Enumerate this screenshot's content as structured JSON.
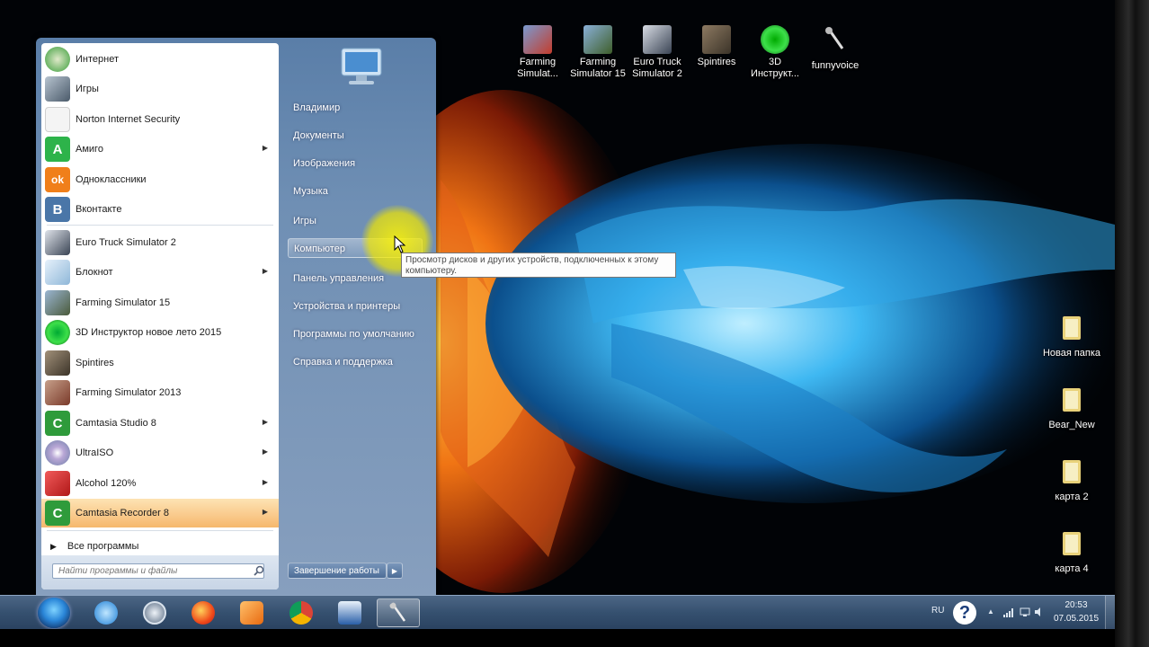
{
  "desktop_icons": [
    {
      "label": "Farming Simulat...",
      "icon": "farming-simulator-icon"
    },
    {
      "label": "Farming Simulator 15",
      "icon": "farming-simulator-15-icon"
    },
    {
      "label": "Euro Truck Simulator 2",
      "icon": "euro-truck-icon"
    },
    {
      "label": "Spintires",
      "icon": "spintires-icon"
    },
    {
      "label": "3D Инструкт...",
      "icon": "3d-instructor-icon"
    },
    {
      "label": "funnyvoice",
      "icon": "microphone-icon"
    },
    {
      "label": "Новая папка",
      "icon": "folder-icon"
    },
    {
      "label": "Bear_New",
      "icon": "folder-icon"
    },
    {
      "label": "карта 2",
      "icon": "folder-icon"
    },
    {
      "label": "карта 4",
      "icon": "folder-icon"
    }
  ],
  "start_menu": {
    "programs": [
      {
        "label": "Интернет",
        "icon": "internet-icon",
        "color": "#3a9d3a"
      },
      {
        "label": "Игры",
        "icon": "games-icon",
        "color": "#6b7b8c"
      },
      {
        "label": "Norton Internet Security",
        "icon": "norton-icon",
        "color": "#f0f0f0"
      },
      {
        "label": "Амиго",
        "icon": "amigo-icon",
        "color": "#2db34a",
        "glyph": "A"
      },
      {
        "label": "Одноклассники",
        "icon": "odnoklassniki-icon",
        "color": "#f07f1a",
        "glyph": "ok"
      },
      {
        "label": "Вконтакте",
        "icon": "vkontakte-icon",
        "color": "#4a76a8",
        "glyph": "B"
      },
      {
        "label": "Euro Truck Simulator 2",
        "icon": "euro-truck-icon",
        "color": "#3a4454"
      },
      {
        "label": "Блокнот",
        "icon": "notepad-icon",
        "color": "#8fb7d8"
      },
      {
        "label": "Farming Simulator 15",
        "icon": "farming-simulator-15-icon",
        "color": "#5a6a4a"
      },
      {
        "label": "3D Инструктор новое лето 2015",
        "icon": "3d-instructor-icon",
        "color": "#1ea32a"
      },
      {
        "label": "Spintires",
        "icon": "spintires-icon",
        "color": "#6d5d4a"
      },
      {
        "label": "Farming Simulator 2013",
        "icon": "farming-simulator-2013-icon",
        "color": "#7a3a2a"
      },
      {
        "label": "Camtasia Studio 8",
        "icon": "camtasia-icon",
        "color": "#2f9b3b",
        "glyph": "C"
      },
      {
        "label": "UltraISO",
        "icon": "ultraiso-icon",
        "color": "#9aa5b8"
      },
      {
        "label": "Alcohol 120%",
        "icon": "alcohol-icon",
        "color": "#d62a2a"
      },
      {
        "label": "Camtasia Recorder 8",
        "icon": "camtasia-recorder-icon",
        "color": "#2f9b3b",
        "glyph": "C"
      }
    ],
    "all_programs": "Все программы",
    "search_placeholder": "Найти программы и файлы",
    "places": [
      "Владимир",
      "Документы",
      "Изображения",
      "Музыка",
      "Игры",
      "Компьютер",
      "Панель управления",
      "Устройства и принтеры",
      "Программы по умолчанию",
      "Справка и поддержка"
    ],
    "shutdown": "Завершение работы"
  },
  "tooltip": "Просмотр дисков и других устройств, подключенных к этому компьютеру.",
  "taskbar": {
    "pinned": [
      "internet-explorer-icon",
      "hp-icon",
      "yandex-icon",
      "media-player-icon",
      "chrome-icon",
      "app-window-icon",
      "microphone-icon"
    ],
    "language": "RU",
    "time": "20:53",
    "date": "07.05.2015"
  }
}
